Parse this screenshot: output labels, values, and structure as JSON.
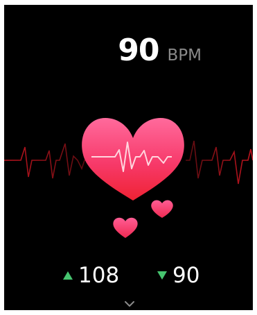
{
  "heart_rate": {
    "value": "90",
    "unit": "BPM"
  },
  "stats": {
    "max_value": "108",
    "min_value": "90"
  },
  "icons": {
    "heart": "heart-icon",
    "max": "triangle-up-icon",
    "min": "triangle-down-icon",
    "more": "chevron-down-icon"
  },
  "colors": {
    "background": "#000000",
    "heart_top": "#ff5a92",
    "heart_bottom": "#f0243a",
    "trace": "#b5121f",
    "stat_indicator": "#46c46f"
  }
}
